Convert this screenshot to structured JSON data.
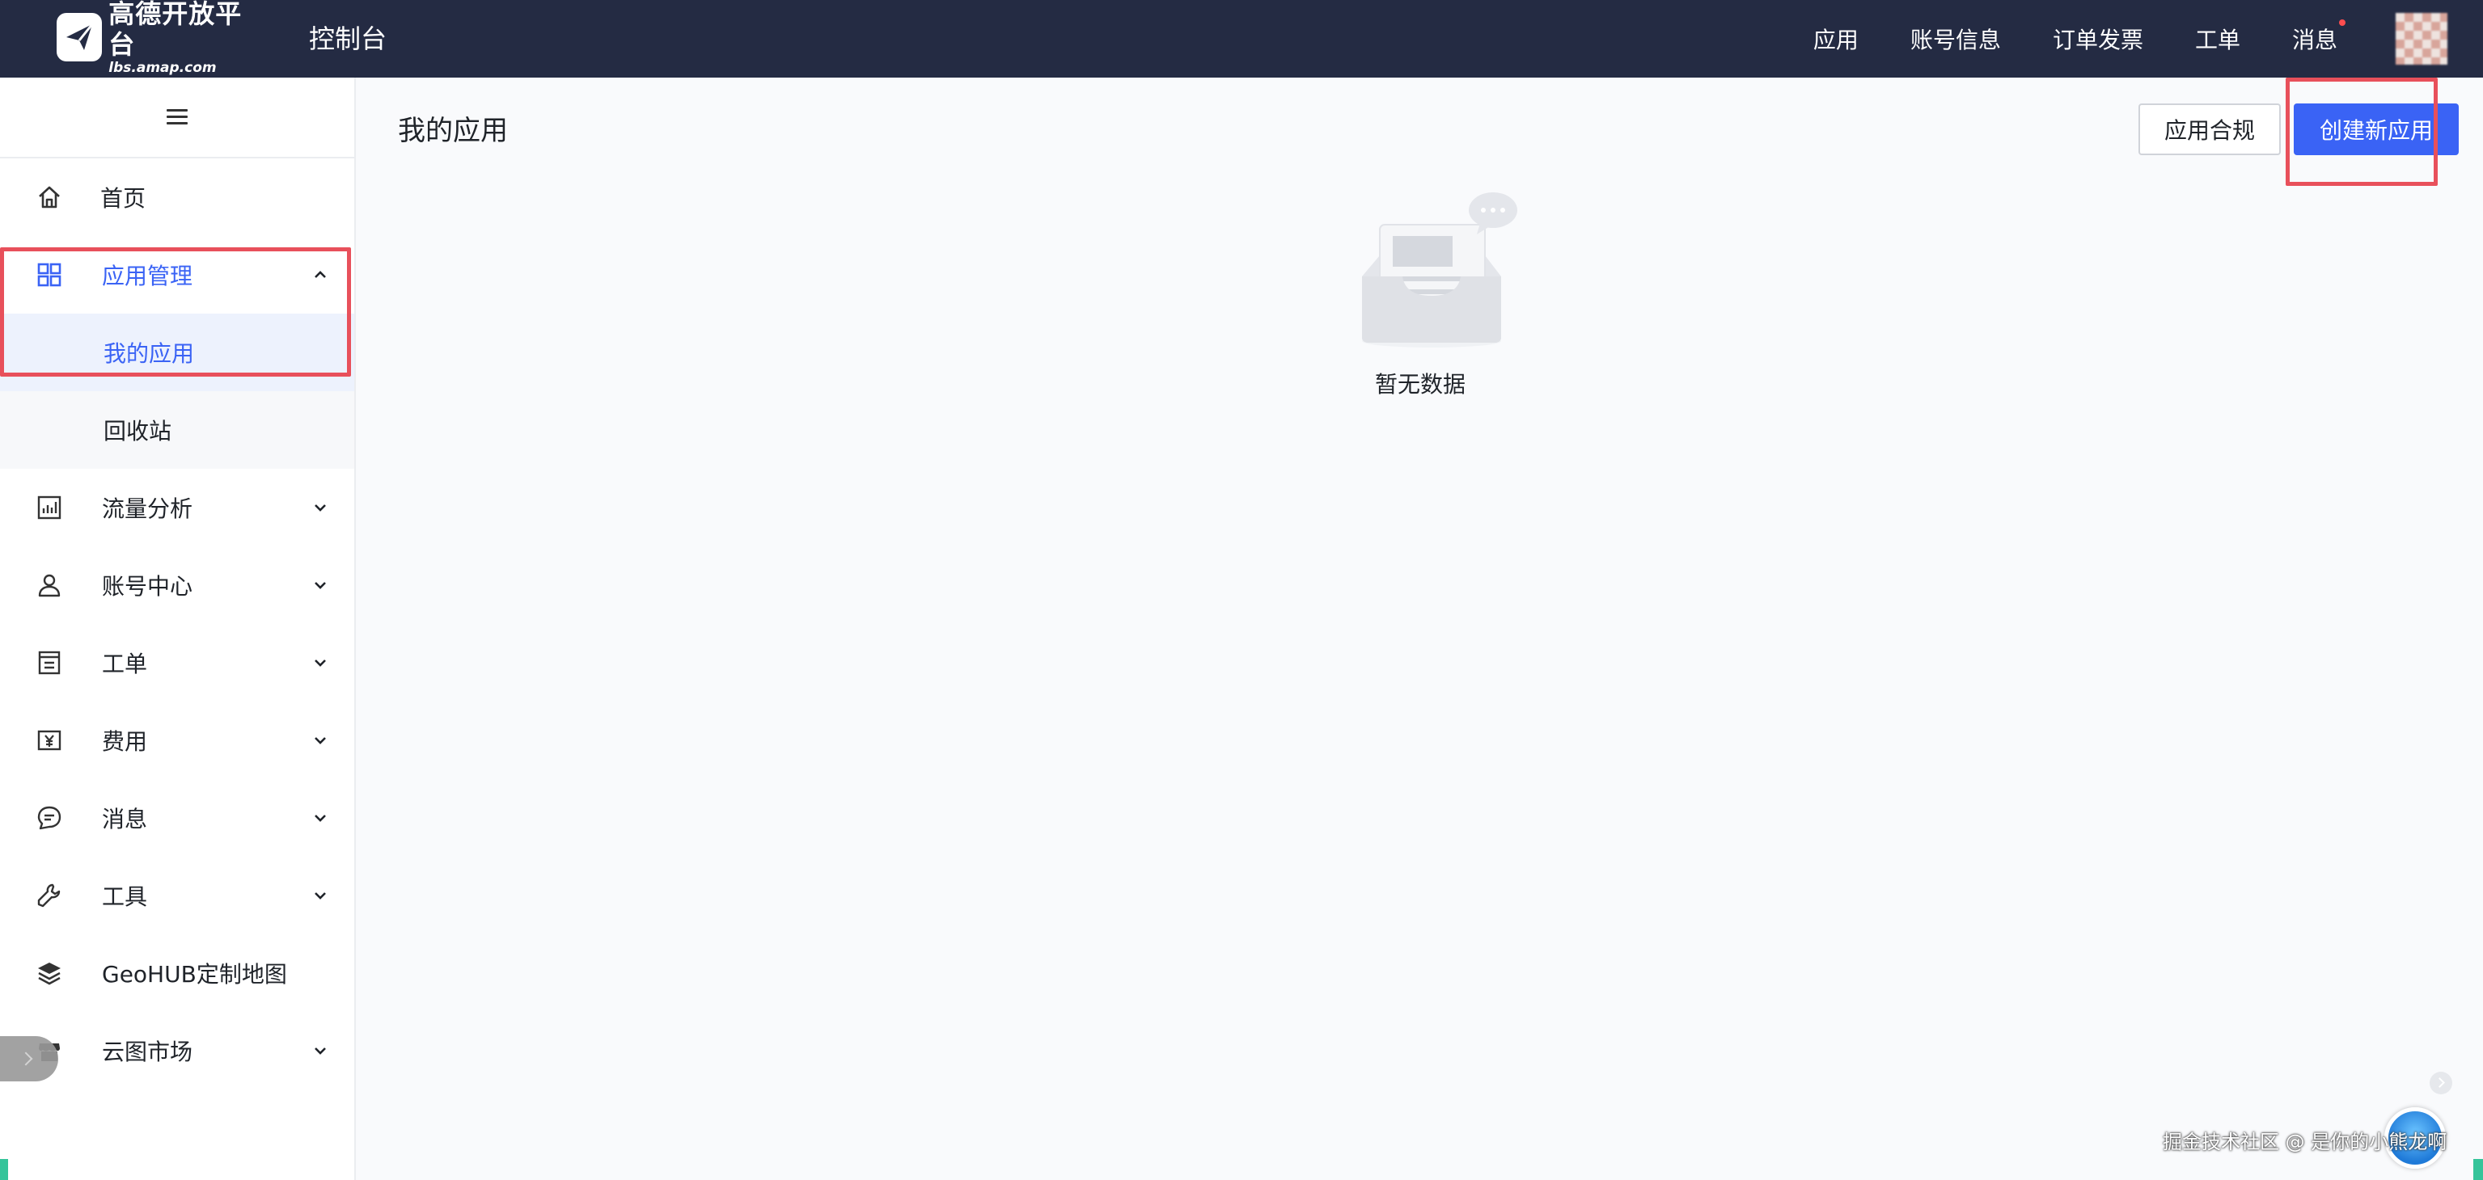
{
  "header": {
    "logo_name": "高德开放平台",
    "logo_domain": "lbs.amap.com",
    "console_title": "控制台",
    "nav": [
      {
        "label": "应用"
      },
      {
        "label": "账号信息"
      },
      {
        "label": "订单发票"
      },
      {
        "label": "工单"
      },
      {
        "label": "消息",
        "has_unread_dot": true
      }
    ]
  },
  "sidebar": {
    "toggle_icon": "hamburger-icon",
    "items": [
      {
        "label": "首页",
        "icon": "home-icon"
      },
      {
        "label": "应用管理",
        "icon": "grid-icon",
        "expanded": true,
        "children": [
          {
            "label": "我的应用",
            "selected": true
          },
          {
            "label": "回收站"
          }
        ]
      },
      {
        "label": "流量分析",
        "icon": "chart-icon"
      },
      {
        "label": "账号中心",
        "icon": "user-icon"
      },
      {
        "label": "工单",
        "icon": "ticket-icon"
      },
      {
        "label": "费用",
        "icon": "yen-icon"
      },
      {
        "label": "消息",
        "icon": "message-icon"
      },
      {
        "label": "工具",
        "icon": "wrench-icon"
      },
      {
        "label": "GeoHUB定制地图",
        "icon": "layers-icon"
      },
      {
        "label": "云图市场",
        "icon": "store-icon"
      }
    ]
  },
  "main": {
    "page_title": "我的应用",
    "buttons": {
      "compliance": "应用合规",
      "create": "创建新应用"
    },
    "empty_state": "暂无数据"
  },
  "footer": {
    "credit": "掘金技术社区 @ 是你的小熊龙啊"
  },
  "colors": {
    "topbar": "#242b43",
    "accent": "#3a63f5",
    "highlight": "#e8505b"
  }
}
